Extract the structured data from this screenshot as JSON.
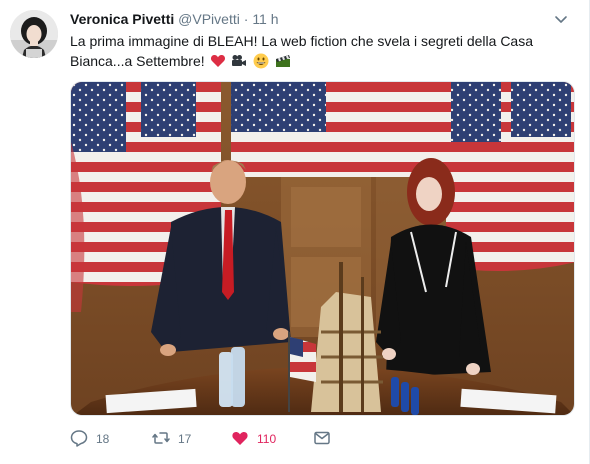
{
  "tweet": {
    "display_name": "Veronica Pivetti",
    "handle": "@VPivetti",
    "separator": "·",
    "time": "11 h",
    "text": "La prima immagine di BLEAH! La web fiction che svela i segreti della Casa Bianca...a Settembre!",
    "emojis": [
      "heart-emoji",
      "movie-camera-emoji",
      "grinning-face-emoji",
      "clapper-board-emoji"
    ],
    "media_icon": "photo"
  },
  "actions": {
    "reply_count": "18",
    "retweet_count": "17",
    "like_count": "110"
  },
  "colors": {
    "text": "#14171a",
    "secondary": "#657786",
    "like": "#e0245e",
    "retweet": "#17bf63",
    "link": "#1da1f2"
  },
  "icons": [
    "chevron-down-icon",
    "reply-icon",
    "retweet-icon",
    "like-icon",
    "direct-message-icon"
  ]
}
